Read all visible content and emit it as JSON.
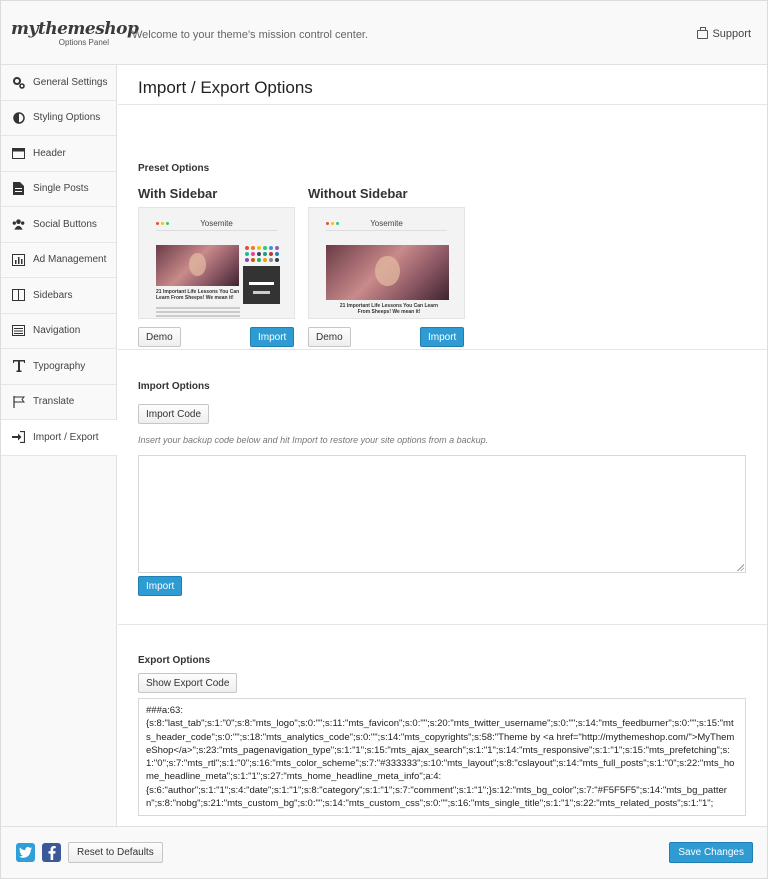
{
  "header": {
    "logo_main": "mythemeshop",
    "logo_sub": "Options Panel",
    "welcome": "Welcome to your theme's mission control center.",
    "support_label": "Support",
    "support_icon": "briefcase-icon"
  },
  "sidebar": {
    "items": [
      {
        "label": "General Settings",
        "icon": "gears-icon"
      },
      {
        "label": "Styling Options",
        "icon": "half-circle-icon"
      },
      {
        "label": "Header",
        "icon": "header-layout-icon"
      },
      {
        "label": "Single Posts",
        "icon": "document-icon"
      },
      {
        "label": "Social Buttons",
        "icon": "users-icon"
      },
      {
        "label": "Ad Management",
        "icon": "bar-chart-icon"
      },
      {
        "label": "Sidebars",
        "icon": "columns-icon"
      },
      {
        "label": "Navigation",
        "icon": "list-icon"
      },
      {
        "label": "Typography",
        "icon": "text-icon"
      },
      {
        "label": "Translate",
        "icon": "flag-icon"
      },
      {
        "label": "Import / Export",
        "icon": "sign-in-icon",
        "active": true
      }
    ]
  },
  "main": {
    "title": "Import / Export Options",
    "preset": {
      "section_title": "Preset Options",
      "cards": [
        {
          "title": "With Sidebar",
          "thumb_site_title": "Yosemite",
          "thumb_caption": "21 Important Life Lessons You Can Learn From Sheeps! We mean it!",
          "demo_label": "Demo",
          "import_label": "Import"
        },
        {
          "title": "Without Sidebar",
          "thumb_site_title": "Yosemite",
          "thumb_caption": "21 Important Life Lessons You Can Learn From Sheeps! We mean it!",
          "demo_label": "Demo",
          "import_label": "Import"
        }
      ]
    },
    "import": {
      "section_title": "Import Options",
      "import_code_label": "Import Code",
      "hint": "Insert your backup code below and hit Import to restore your site options from a backup.",
      "textarea_value": "",
      "import_label": "Import"
    },
    "export": {
      "section_title": "Export Options",
      "show_label": "Show Export Code",
      "code": "###a:63:\n{s:8:\"last_tab\";s:1:\"0\";s:8:\"mts_logo\";s:0:\"\";s:11:\"mts_favicon\";s:0:\"\";s:20:\"mts_twitter_username\";s:0:\"\";s:14:\"mts_feedburner\";s:0:\"\";s:15:\"mts_header_code\";s:0:\"\";s:18:\"mts_analytics_code\";s:0:\"\";s:14:\"mts_copyrights\";s:58:\"Theme by <a href=\"http://mythemeshop.com/\">MyThemeShop</a>\";s:23:\"mts_pagenavigation_type\";s:1:\"1\";s:15:\"mts_ajax_search\";s:1:\"1\";s:14:\"mts_responsive\";s:1:\"1\";s:15:\"mts_prefetching\";s:1:\"0\";s:7:\"mts_rtl\";s:1:\"0\";s:16:\"mts_color_scheme\";s:7:\"#333333\";s:10:\"mts_layout\";s:8:\"cslayout\";s:14:\"mts_full_posts\";s:1:\"0\";s:22:\"mts_home_headline_meta\";s:1:\"1\";s:27:\"mts_home_headline_meta_info\";a:4:\n{s:6:\"author\";s:1:\"1\";s:4:\"date\";s:1:\"1\";s:8:\"category\";s:1:\"1\";s:7:\"comment\";s:1:\"1\";}s:12:\"mts_bg_color\";s:7:\"#F5F5F5\";s:14:\"mts_bg_pattern\";s:8:\"nobg\";s:21:\"mts_custom_bg\";s:0:\"\";s:14:\"mts_custom_css\";s:0:\"\";s:16:\"mts_single_title\";s:1:\"1\";s:22:\"mts_related_posts\";s:1:\"1\";"
    }
  },
  "footer": {
    "twitter_icon": "twitter-icon",
    "facebook_icon": "facebook-icon",
    "reset_label": "Reset to Defaults",
    "save_label": "Save Changes"
  },
  "colors": {
    "accent": "#2f9bd3",
    "twitter": "#2e9fd9",
    "facebook": "#3b5998"
  }
}
